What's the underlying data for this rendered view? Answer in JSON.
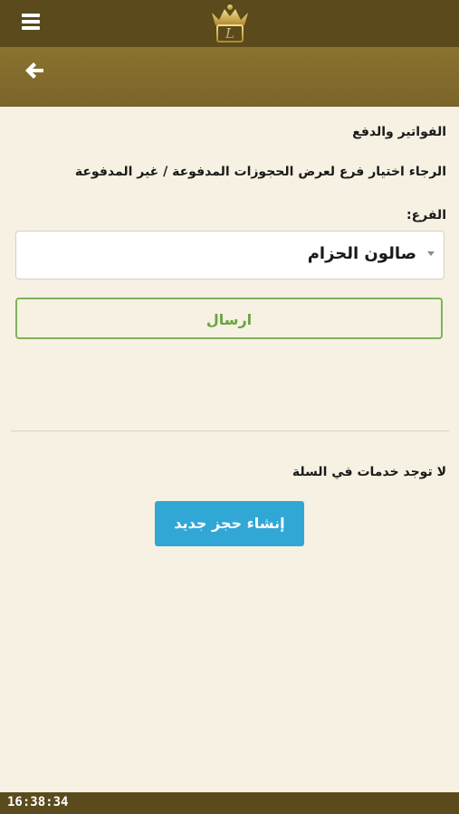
{
  "header": {
    "menu_icon": "hamburger-menu-icon",
    "logo_icon": "crown-logo-icon",
    "back_icon": "arrow-left-icon"
  },
  "page": {
    "section_title": "الفواتير والدفع",
    "instruction": "الرجاء اختيار فرع لعرض الحجوزات المدفوعة / غير المدفوعة",
    "branch_label": "الفرع:",
    "branch_selected": "صالون الحزام",
    "send_label": "ارسال"
  },
  "cart": {
    "empty_message": "لا توجد خدمات في السلة",
    "new_booking_label": "إنشاء حجز جديد"
  },
  "footer": {
    "time": "16:38:34"
  },
  "colors": {
    "topbar": "#5a4a1c",
    "subbar": "#7a6429",
    "background": "#f6f1e2",
    "send_border": "#7fb25a",
    "primary_button": "#31a7d6"
  }
}
